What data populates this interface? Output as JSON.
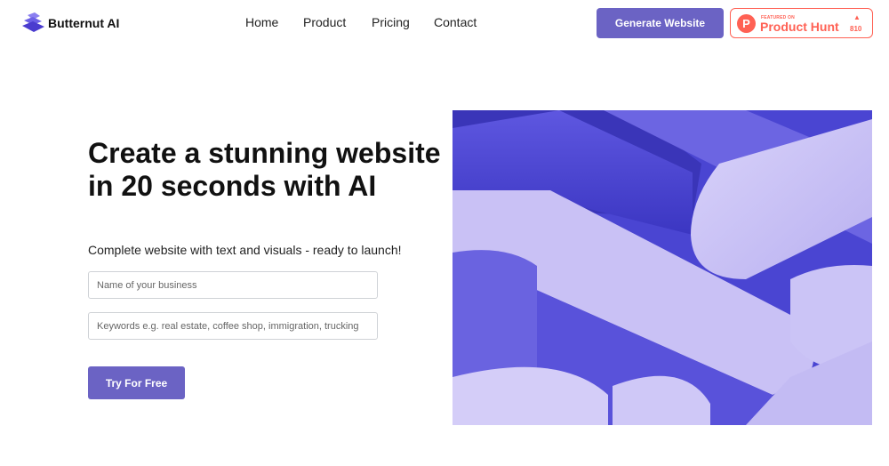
{
  "brand": {
    "name": "Butternut AI",
    "logo_icon": "stacked-layers-icon",
    "colors": {
      "primary": "#6b63c4",
      "logo": "#5b4fd8",
      "product_hunt": "#ff6154"
    }
  },
  "nav": {
    "items": [
      {
        "label": "Home"
      },
      {
        "label": "Product"
      },
      {
        "label": "Pricing"
      },
      {
        "label": "Contact"
      }
    ]
  },
  "header": {
    "cta_label": "Generate Website",
    "product_hunt": {
      "logo_letter": "P",
      "featured_label": "FEATURED ON",
      "name": "Product Hunt",
      "upvote_icon": "up-triangle-icon",
      "count": "810"
    }
  },
  "hero": {
    "headline": "Create a stunning website in 20 seconds with AI",
    "subheadline": "Complete website with text and visuals - ready to launch!",
    "business_placeholder": "Name of your business",
    "keywords_placeholder": "Keywords e.g. real estate, coffee shop, immigration, trucking",
    "submit_label": "Try For Free",
    "art_colors": {
      "dark": "#4844d4",
      "mid": "#6a63e0",
      "light": "#c8c0f4"
    }
  }
}
